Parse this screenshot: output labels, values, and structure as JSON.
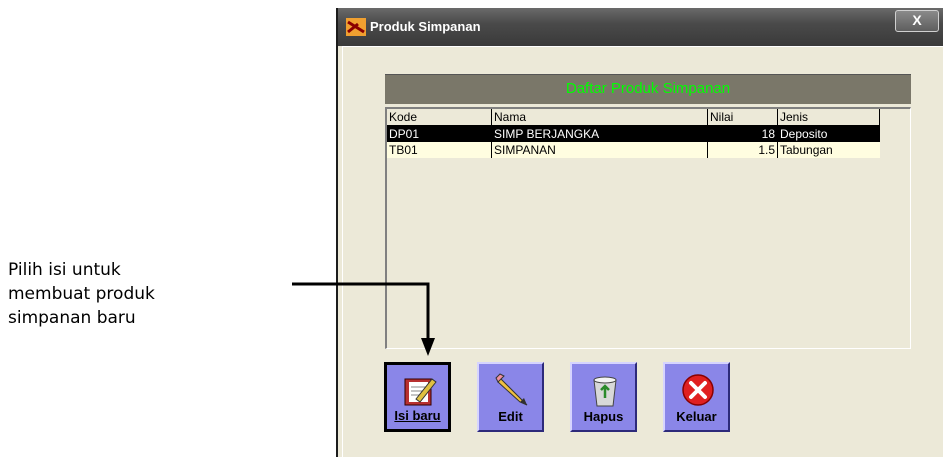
{
  "annotation": {
    "lines": [
      "Pilih isi untuk",
      "membuat produk",
      "simpanan baru"
    ]
  },
  "window": {
    "title": "Produk Simpanan",
    "close_label": "X"
  },
  "list": {
    "header": "Daftar Produk Simpanan",
    "columns": [
      "Kode",
      "Nama",
      "Nilai",
      "Jenis"
    ],
    "rows": [
      {
        "kode": "DP01",
        "nama": "SIMP BERJANGKA",
        "nilai": "18",
        "jenis": "Deposito"
      },
      {
        "kode": "TB01",
        "nama": "SIMPANAN",
        "nilai": "1.5",
        "jenis": "Tabungan"
      }
    ]
  },
  "buttons": {
    "isi_baru": "Isi baru",
    "edit": "Edit",
    "hapus": "Hapus",
    "keluar": "Keluar"
  },
  "icons": {
    "isi_baru": "notebook-pencil-icon",
    "edit": "pencil-icon",
    "hapus": "recycle-bin-icon",
    "keluar": "red-x-icon"
  },
  "colors": {
    "header_text": "#00ff00",
    "button_face": "#8a86e8"
  }
}
